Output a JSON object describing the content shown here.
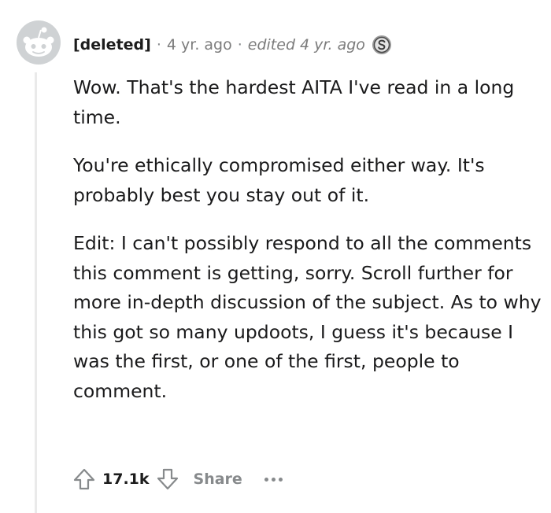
{
  "comment": {
    "author": "[deleted]",
    "time": "4 yr. ago",
    "edited": "edited 4 yr. ago",
    "separator": "·",
    "avatar_icon": "deleted-user-avatar-icon",
    "award_icon": "silver-award-icon",
    "paragraphs": [
      "Wow. That's the hardest AITA I've read in a long time.",
      "You're ethically compromised either way. It's probably best you stay out of it.",
      "Edit: I can't possibly respond to all the comments this comment is getting, sorry. Scroll further for more in-depth discussion of the subject. As to why this got so many updoots, I guess it's because I was the first, or one of the first, people to comment."
    ]
  },
  "actions": {
    "score": "17.1k",
    "share_label": "Share",
    "upvote_icon": "upvote-arrow-icon",
    "downvote_icon": "downvote-arrow-icon",
    "more_icon": "more-options-icon"
  },
  "colors": {
    "text": "#1a1a1b",
    "meta_gray": "#7c7c7c",
    "action_gray": "#878a8c",
    "thread_line": "#eaeaea",
    "avatar_gray": "#cfd2d4"
  }
}
